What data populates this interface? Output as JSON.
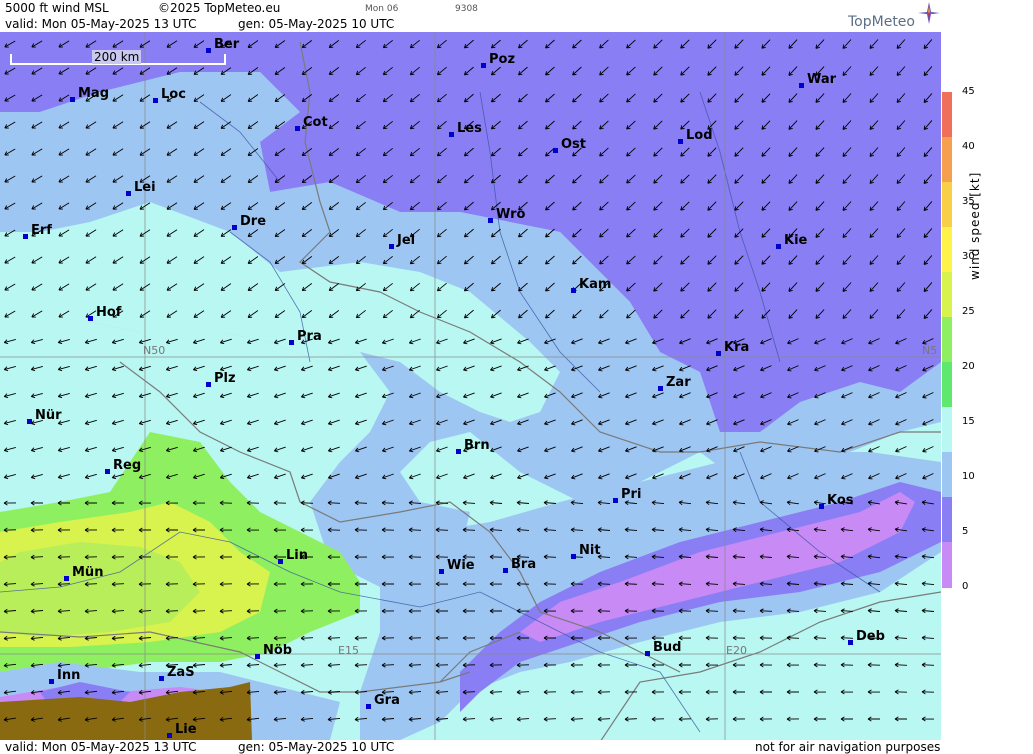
{
  "header": {
    "title": "5000 ft wind MSL",
    "copyright": "©2025 TopMeteo.eu",
    "day_tab": "Mon 06",
    "code": "9308",
    "valid": "valid:  Mon  05-May-2025  13 UTC",
    "gen": "gen: 05-May-2025 10 UTC"
  },
  "logo": {
    "text": "TopMeteo",
    "icon": "compass-star-icon"
  },
  "scale": {
    "label": "200 km"
  },
  "grid_labels": {
    "n50": "N50",
    "n50_right": "N5",
    "e15": "E15",
    "e20": "E20"
  },
  "cities": [
    {
      "name": "Ber"
    },
    {
      "name": "Poz"
    },
    {
      "name": "War"
    },
    {
      "name": "Mag"
    },
    {
      "name": "Loc"
    },
    {
      "name": "Cot"
    },
    {
      "name": "Les"
    },
    {
      "name": "Ost"
    },
    {
      "name": "Lod"
    },
    {
      "name": "Lei"
    },
    {
      "name": "Dre"
    },
    {
      "name": "Wro"
    },
    {
      "name": "Erf"
    },
    {
      "name": "Jel"
    },
    {
      "name": "Kie"
    },
    {
      "name": "Kam"
    },
    {
      "name": "Hof"
    },
    {
      "name": "Pra"
    },
    {
      "name": "Kra"
    },
    {
      "name": "Zar"
    },
    {
      "name": "Plz"
    },
    {
      "name": "Nür"
    },
    {
      "name": "Brn"
    },
    {
      "name": "Reg"
    },
    {
      "name": "Pri"
    },
    {
      "name": "Kos"
    },
    {
      "name": "Nit"
    },
    {
      "name": "Lin"
    },
    {
      "name": "Mün"
    },
    {
      "name": "Wie"
    },
    {
      "name": "Bra"
    },
    {
      "name": "Deb"
    },
    {
      "name": "Bud"
    },
    {
      "name": "Nöb"
    },
    {
      "name": "Inn"
    },
    {
      "name": "ZaS"
    },
    {
      "name": "Gra"
    },
    {
      "name": "Lie"
    }
  ],
  "legend": {
    "title": "wind speed [kt]",
    "ticks": [
      "45",
      "40",
      "35",
      "30",
      "25",
      "20",
      "15",
      "10",
      "5",
      "0"
    ],
    "colors": [
      "#ef6f5a",
      "#f5a04e",
      "#f8d048",
      "#fff34a",
      "#d8f24e",
      "#8ef060",
      "#5ee86e",
      "#b8f7f2",
      "#9ec6f2",
      "#8a7ef5",
      "#c88af5"
    ]
  },
  "footer": {
    "valid": "valid:  Mon  05-May-2025  13 UTC",
    "gen": "gen: 05-May-2025 10 UTC",
    "note": "not for air navigation purposes"
  }
}
